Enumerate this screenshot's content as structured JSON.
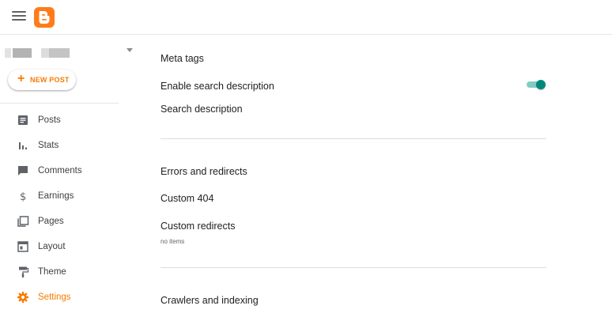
{
  "header": {
    "menu_icon": "hamburger-menu-icon",
    "logo_icon": "blogger-logo-icon",
    "brand_color": "#ff7b1a"
  },
  "sidebar": {
    "new_post_label": "NEW POST",
    "new_post_icon": "+",
    "items": [
      {
        "label": "Posts",
        "icon": "posts-icon"
      },
      {
        "label": "Stats",
        "icon": "stats-icon"
      },
      {
        "label": "Comments",
        "icon": "comments-icon"
      },
      {
        "label": "Earnings",
        "icon": "dollar-icon"
      },
      {
        "label": "Pages",
        "icon": "pages-icon"
      },
      {
        "label": "Layout",
        "icon": "layout-icon"
      },
      {
        "label": "Theme",
        "icon": "paint-roller-icon"
      },
      {
        "label": "Settings",
        "icon": "gear-icon",
        "active": true
      }
    ],
    "active_color": "#f57c00"
  },
  "main": {
    "meta_tags": {
      "title": "Meta tags",
      "enable_search_description": "Enable search description",
      "enable_search_description_on": true,
      "search_description": "Search description"
    },
    "errors_redirects": {
      "title": "Errors and redirects",
      "custom_404": "Custom 404",
      "custom_redirects": "Custom redirects",
      "custom_redirects_sub": "no items"
    },
    "crawlers": {
      "title": "Crawlers and indexing"
    },
    "toggle_color": "#00897b"
  }
}
